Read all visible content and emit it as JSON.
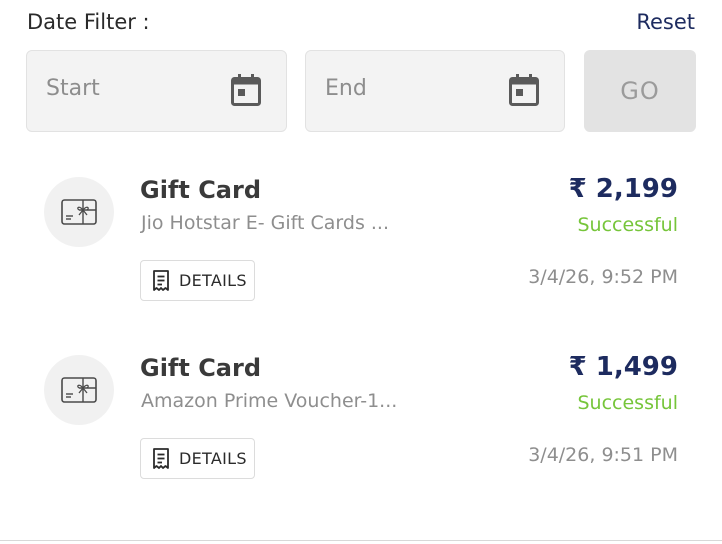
{
  "filter": {
    "title": "Date Filter :",
    "reset_label": "Reset",
    "start_placeholder": "Start",
    "end_placeholder": "End",
    "go_label": "GO"
  },
  "transactions": [
    {
      "icon": "gift-card-icon",
      "title": "Gift Card",
      "description": "Jio Hotstar E- Gift Cards ...",
      "amount": "₹ 2,199",
      "status": "Successful",
      "details_label": "DETAILS",
      "timestamp": "3/4/26, 9:52 PM"
    },
    {
      "icon": "gift-card-icon",
      "title": "Gift Card",
      "description": "Amazon Prime Voucher-1...",
      "amount": "₹ 1,499",
      "status": "Successful",
      "details_label": "DETAILS",
      "timestamp": "3/4/26, 9:51 PM"
    }
  ],
  "colors": {
    "accent": "#1d2b5f",
    "success": "#76c53a",
    "muted": "#8e8e8e"
  }
}
